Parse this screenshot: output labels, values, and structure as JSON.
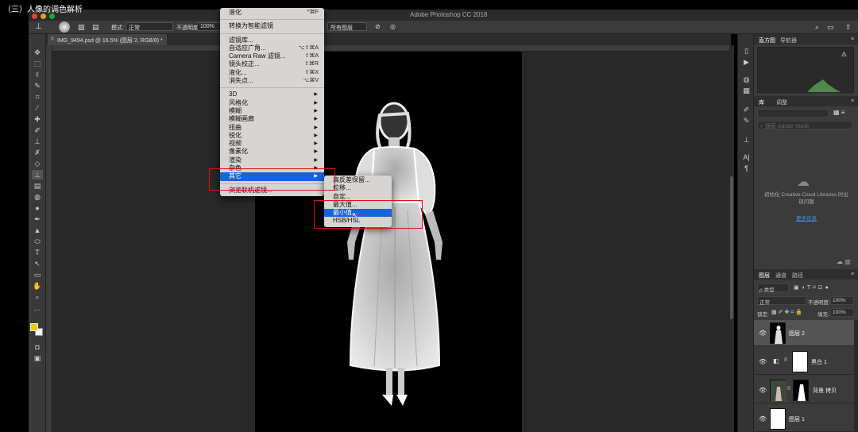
{
  "video_title": "（三）人像的调色解析",
  "app_title": "Adobe Photoshop CC 2018",
  "colors": {
    "highlight": "#1664d8",
    "annotation": "#e01010",
    "foreground_swatch": "#f3c60f"
  },
  "options_bar": {
    "mode_label": "模式:",
    "mode_value": "正常",
    "opacity_label": "不透明度:",
    "opacity_value": "100%",
    "sample_value": "所有图层"
  },
  "document": {
    "tab_title": "IMG_9494.psd @ 16.5% (图层 2, RGB/8) *"
  },
  "filter_menu": {
    "items": [
      {
        "label": "液化",
        "shortcut": "^⌘F"
      },
      {
        "sep": true
      },
      {
        "label": "转换为智能滤镜"
      },
      {
        "sep": true
      },
      {
        "label": "滤镜库..."
      },
      {
        "label": "自适应广角...",
        "shortcut": "⌥⇧⌘A"
      },
      {
        "label": "Camera Raw 滤镜...",
        "shortcut": "⇧⌘A"
      },
      {
        "label": "镜头校正...",
        "shortcut": "⇧⌘R"
      },
      {
        "label": "液化...",
        "shortcut": "⇧⌘X"
      },
      {
        "label": "消失点...",
        "shortcut": "⌥⌘V"
      },
      {
        "sep": true
      },
      {
        "label": "3D",
        "submenu": true
      },
      {
        "label": "风格化",
        "submenu": true
      },
      {
        "label": "模糊",
        "submenu": true
      },
      {
        "label": "模糊画廊",
        "submenu": true
      },
      {
        "label": "扭曲",
        "submenu": true
      },
      {
        "label": "锐化",
        "submenu": true
      },
      {
        "label": "视频",
        "submenu": true
      },
      {
        "label": "像素化",
        "submenu": true
      },
      {
        "label": "渲染",
        "submenu": true
      },
      {
        "label": "杂色",
        "submenu": true
      },
      {
        "label": "其它",
        "submenu": true,
        "highlighted": true
      },
      {
        "sep": true
      },
      {
        "label": "浏览联机滤镜..."
      }
    ]
  },
  "other_submenu": {
    "items": [
      {
        "label": "高反差保留..."
      },
      {
        "label": "位移..."
      },
      {
        "label": "自定..."
      },
      {
        "label": "最大值..."
      },
      {
        "label": "最小值...",
        "highlighted": true
      },
      {
        "label": "HSB/HSL"
      }
    ]
  },
  "panels": {
    "top_tabs": [
      "直方图",
      "导航器"
    ],
    "lib_tabs": [
      "库",
      "调整"
    ],
    "lib_search_placeholder": "搜索 Adobe Stock",
    "cc_message": "初始化 Creative Cloud Libraries 时出现问题",
    "cc_link": "更多信息",
    "layers_tabs": [
      "图层",
      "通道",
      "路径"
    ],
    "layer_filter": "ρ 类型",
    "blend_mode": "正常",
    "opacity_label": "不透明度:",
    "opacity_value": "100%",
    "lock_label": "锁定:",
    "fill_label": "填充:",
    "fill_value": "100%",
    "layers": [
      {
        "name": "图层 2",
        "selected": true
      },
      {
        "name": "黑白 1"
      },
      {
        "name": "背景 拷贝"
      },
      {
        "name": "图层 1"
      }
    ]
  }
}
